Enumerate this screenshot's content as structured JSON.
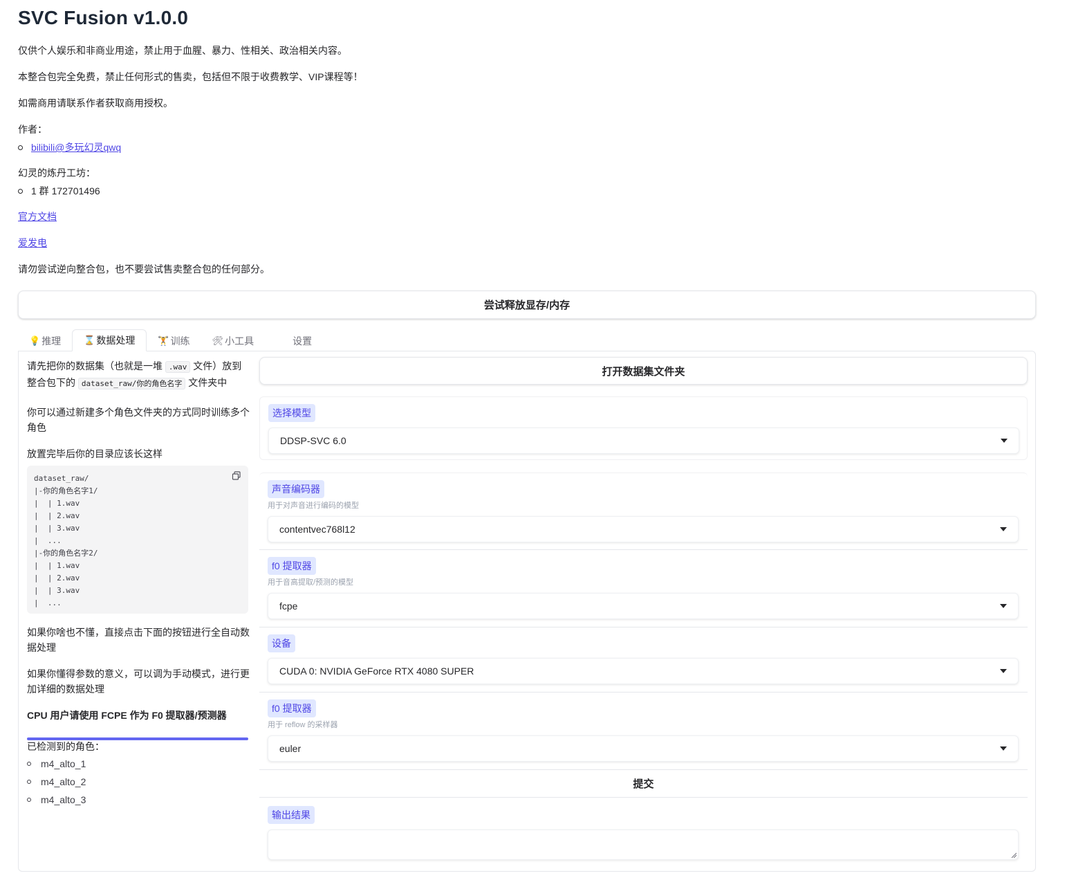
{
  "header": {
    "title": "SVC Fusion v1.0.0",
    "notice1": "仅供个人娱乐和非商业用途，禁止用于血腥、暴力、性相关、政治相关内容。",
    "notice2": "本整合包完全免费，禁止任何形式的售卖，包括但不限于收费教学、VIP课程等！",
    "notice3": "如需商用请联系作者获取商用授权。",
    "author_label": "作者：",
    "author_link": "bilibili@多玩幻灵qwq",
    "workshop_label": "幻灵的炼丹工坊：",
    "group": "1 群 172701496",
    "docs_link": "官方文档",
    "afdian_link": "爱发电",
    "notice4": "请勿尝试逆向整合包，也不要尝试售卖整合包的任何部分。"
  },
  "free_memory_button": "尝试释放显存/内存",
  "tabs": [
    {
      "icon": "💡",
      "label": "推理"
    },
    {
      "icon": "⌛",
      "label": "数据处理"
    },
    {
      "icon": "🏋",
      "label": "训练"
    },
    {
      "icon": "🛠",
      "label": "小工具"
    },
    {
      "icon": "",
      "label": "设置"
    }
  ],
  "left": {
    "p1_a": "请先把你的数据集（也就是一堆 ",
    "p1_code1": ".wav",
    "p1_b": " 文件）放到",
    "p1_c": "整合包下的 ",
    "p1_code2": "dataset_raw/你的角色名字",
    "p1_d": " 文件夹中",
    "p2": "你可以通过新建多个角色文件夹的方式同时训练多个角色",
    "p3": "放置完毕后你的目录应该长这样",
    "code_lines": [
      "dataset_raw/",
      "|-你的角色名字1/",
      "|  | 1.wav",
      "|  | 2.wav",
      "|  | 3.wav",
      "|  ...",
      "|-你的角色名字2/",
      "|  | 1.wav",
      "|  | 2.wav",
      "|  | 3.wav",
      "|  ..."
    ],
    "p4": "如果你啥也不懂，直接点击下面的按钮进行全自动数据处理",
    "p5": "如果你懂得参数的意义，可以调为手动模式，进行更加详细的数据处理",
    "p6": "CPU 用户请使用 FCPE 作为 F0 提取器/预测器",
    "detected_label": "已检测到的角色：",
    "characters": [
      "m4_alto_1",
      "m4_alto_2",
      "m4_alto_3"
    ]
  },
  "right": {
    "open_dataset_button": "打开数据集文件夹",
    "model": {
      "label": "选择模型",
      "value": "DDSP-SVC 6.0"
    },
    "encoder": {
      "label": "声音编码器",
      "info": "用于对声音进行编码的模型",
      "value": "contentvec768l12"
    },
    "f0": {
      "label": "f0 提取器",
      "info": "用于音高提取/预测的模型",
      "value": "fcpe"
    },
    "device": {
      "label": "设备",
      "value": "CUDA 0: NVIDIA GeForce RTX 4080 SUPER"
    },
    "sampler": {
      "label": "f0 提取器",
      "info": "用于 reflow 的采样器",
      "value": "euler"
    },
    "submit_button": "提交",
    "output_label": "输出结果",
    "output_value": ""
  }
}
